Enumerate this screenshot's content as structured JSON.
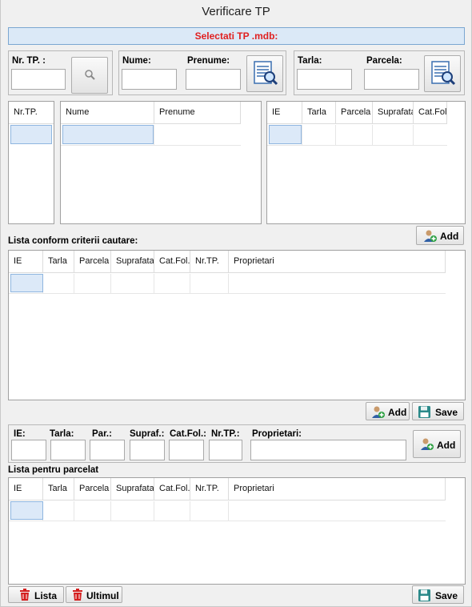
{
  "window": {
    "title": "Verificare TP"
  },
  "banner": {
    "text": "Selectati TP .mdb:"
  },
  "search": {
    "nrtp_label": "Nr. TP. :",
    "nume_label": "Nume:",
    "prenume_label": "Prenume:",
    "tarla_label": "Tarla:",
    "parcela_label": "Parcela:"
  },
  "grid_nrtp": {
    "columns": [
      "Nr.TP."
    ]
  },
  "grid_owners": {
    "columns": [
      "Nume",
      "Prenume"
    ]
  },
  "grid_parcels": {
    "columns": [
      "IE",
      "Tarla",
      "Parcela",
      "Suprafata",
      "Cat.Fol."
    ]
  },
  "buttons": {
    "add": "Add",
    "save": "Save",
    "lista": "Lista",
    "ultimul": "Ultimul"
  },
  "section1": {
    "title": "Lista conform criterii cautare:",
    "columns": [
      "IE",
      "Tarla",
      "Parcela",
      "Suprafata",
      "Cat.Fol.",
      "Nr.TP.",
      "Proprietari"
    ]
  },
  "entry": {
    "ie_label": "IE:",
    "tarla_label": "Tarla:",
    "par_label": "Par.:",
    "supraf_label": "Supraf.:",
    "catfol_label": "Cat.Fol.:",
    "nrtp_label": "Nr.TP.:",
    "proprietari_label": "Proprietari:"
  },
  "section2": {
    "title": "Lista pentru parcelat",
    "columns": [
      "IE",
      "Tarla",
      "Parcela",
      "Suprafata",
      "Cat.Fol.",
      "Nr.TP.",
      "Proprietari"
    ]
  },
  "colors": {
    "banner_text": "#e02020",
    "banner_bg": "#dbe9f7",
    "selected_cell": "#dce9f8"
  },
  "icons": [
    "search-icon",
    "document-search-icon",
    "add-user-icon",
    "save-disk-icon",
    "trash-icon"
  ]
}
